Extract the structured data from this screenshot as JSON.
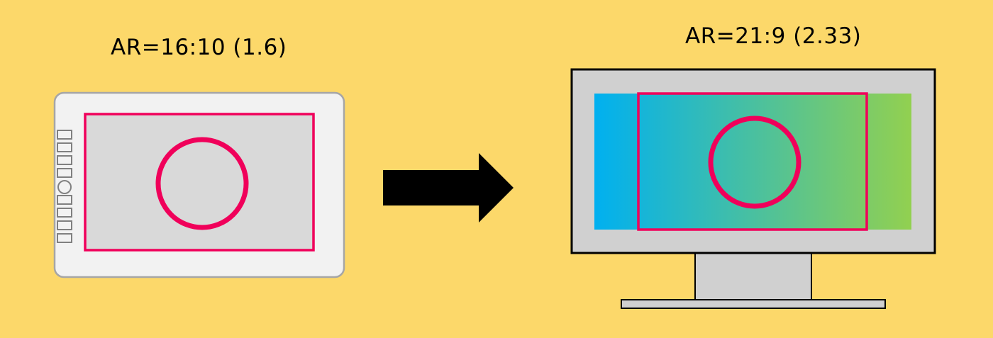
{
  "tablet": {
    "aspect_ratio_label": "AR=16:10 (1.6)",
    "express_key_count": 8
  },
  "monitor": {
    "aspect_ratio_label": "AR=21:9 (2.33)"
  },
  "colors": {
    "background": "#FCD86A",
    "highlight": "#F0005A",
    "tablet_body": "#F2F2F2",
    "tablet_border": "#A6A6A6",
    "tablet_active_area": "#D9D9D9",
    "monitor_bezel": "#D0D0D0",
    "monitor_gradient_start": "#00B0F0",
    "monitor_gradient_end": "#92D050",
    "arrow": "#000000"
  }
}
